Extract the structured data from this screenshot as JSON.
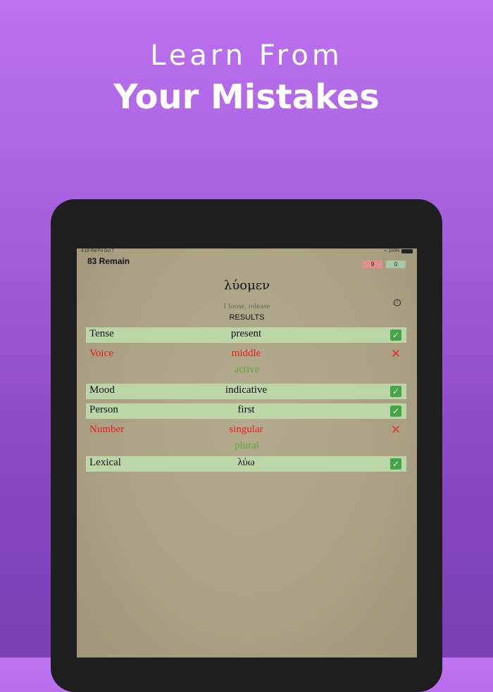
{
  "marketing": {
    "line1": "Learn From",
    "line2": "Your Mistakes"
  },
  "status_bar": {
    "time": "4:19 PM  Fri Oct 7",
    "battery": "100%"
  },
  "header": {
    "remaining": "83 Remain",
    "wrong_count": "9",
    "right_count": "0"
  },
  "word": {
    "greek": "λύομεν",
    "gloss": "I loose, release",
    "info_icon": "info-icon"
  },
  "results_label": "RESULTS",
  "rows": [
    {
      "label": "Tense",
      "value": "present",
      "correct": true,
      "icon": "check-icon"
    },
    {
      "label": "Voice",
      "value": "middle",
      "correct": false,
      "answer": "active",
      "icon": "cross-icon"
    },
    {
      "label": "Mood",
      "value": "indicative",
      "correct": true,
      "icon": "check-icon"
    },
    {
      "label": "Person",
      "value": "first",
      "correct": true,
      "icon": "check-icon"
    },
    {
      "label": "Number",
      "value": "singular",
      "correct": false,
      "answer": "plural",
      "icon": "cross-icon"
    },
    {
      "label": "Lexical",
      "value": "λύω",
      "correct": true,
      "icon": "check-icon"
    }
  ],
  "colors": {
    "correct_bg": "#bcd6a8",
    "wrong_text": "#e41d1d",
    "answer_text": "#5faa38",
    "check_bg": "#43a547"
  }
}
